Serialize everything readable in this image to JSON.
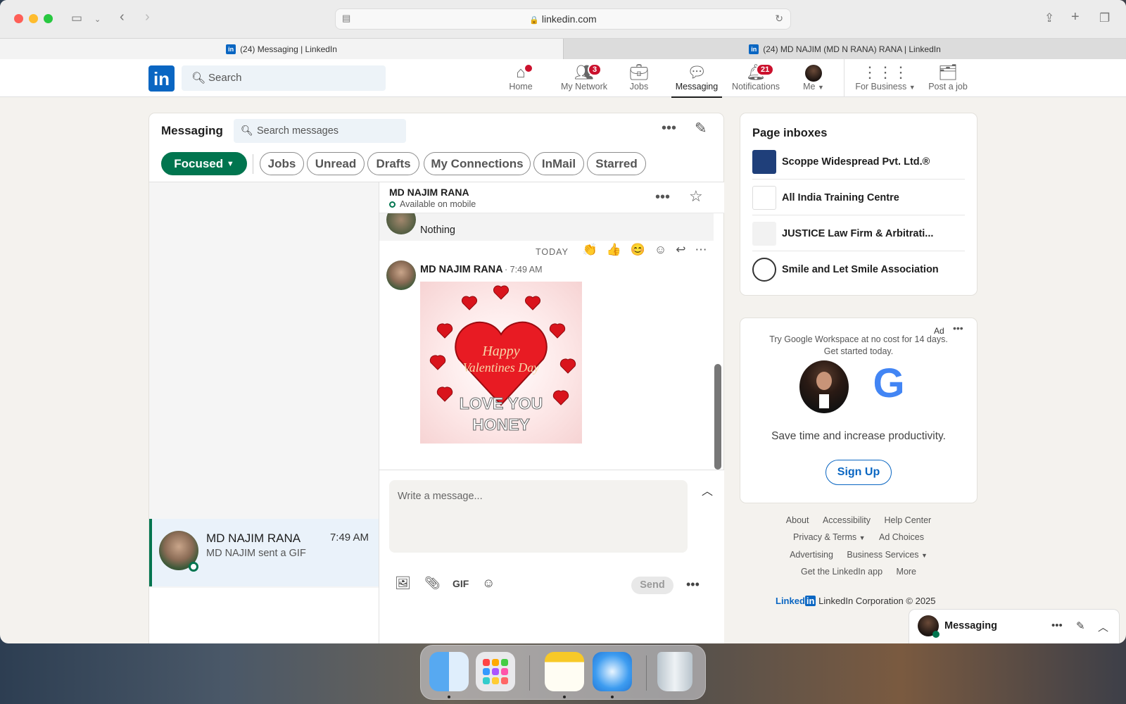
{
  "browser": {
    "url": "linkedin.com",
    "tabs": [
      {
        "label": "(24) Messaging | LinkedIn"
      },
      {
        "label": "(24) MD NAJIM (MD N RANA) RANA | LinkedIn"
      }
    ]
  },
  "nav": {
    "logo": "in",
    "search_placeholder": "Search",
    "items": [
      {
        "label": "Home",
        "badge": "",
        "icon": "home-icon"
      },
      {
        "label": "My Network",
        "badge": "3",
        "icon": "network-icon"
      },
      {
        "label": "Jobs",
        "badge": "",
        "icon": "briefcase-icon"
      },
      {
        "label": "Messaging",
        "badge": "",
        "icon": "messaging-icon"
      },
      {
        "label": "Notifications",
        "badge": "21",
        "icon": "bell-icon"
      },
      {
        "label": "Me",
        "badge": "",
        "icon": "avatar"
      },
      {
        "label": "For Business",
        "badge": "",
        "icon": "grid-icon"
      },
      {
        "label": "Post a job",
        "badge": "",
        "icon": "post-job-icon"
      }
    ]
  },
  "messaging": {
    "title": "Messaging",
    "search_placeholder": "Search messages",
    "filters": [
      "Focused",
      "Jobs",
      "Unread",
      "Drafts",
      "My Connections",
      "InMail",
      "Starred"
    ],
    "conversation": {
      "name": "MD NAJIM RANA",
      "time": "7:49 AM",
      "preview": "MD NAJIM sent a GIF"
    },
    "thread": {
      "name": "MD NAJIM RANA",
      "status": "Available on mobile",
      "previous_message": "Nothing",
      "day_divider": "TODAY",
      "message": {
        "sender": "MD NAJIM RANA",
        "time": "· 7:49 AM",
        "gif_text_1": "Happy",
        "gif_text_2": "Valentines Day",
        "gif_text_3": "LOVE YOU",
        "gif_text_4": "HONEY"
      },
      "reactions": [
        "👏",
        "👍",
        "😊"
      ]
    },
    "composer": {
      "placeholder": "Write a message...",
      "gif_label": "GIF",
      "send_label": "Send"
    }
  },
  "inboxes": {
    "title": "Page inboxes",
    "items": [
      {
        "name": "Scoppe Widespread Pvt. Ltd.®"
      },
      {
        "name": "All India Training Centre"
      },
      {
        "name": "JUSTICE Law Firm & Arbitrati..."
      },
      {
        "name": "Smile and Let Smile Association"
      }
    ]
  },
  "ad": {
    "label": "Ad",
    "line1": "Try Google Workspace at no cost for 14 days.",
    "line2": "Get started today.",
    "google_letter": "G",
    "tagline": "Save time and increase productivity.",
    "cta": "Sign Up"
  },
  "footer": {
    "about": "About",
    "accessibility": "Accessibility",
    "help": "Help Center",
    "privacy": "Privacy & Terms",
    "adchoices": "Ad Choices",
    "advertising": "Advertising",
    "business": "Business Services",
    "app": "Get the LinkedIn app",
    "more": "More",
    "brand": "Linked",
    "brand_in": "in",
    "copyright": "LinkedIn Corporation © 2025"
  },
  "mini_messaging": {
    "label": "Messaging"
  },
  "colors": {
    "brand": "#0a66c2",
    "green": "#01754f",
    "badge": "#cb112d"
  }
}
